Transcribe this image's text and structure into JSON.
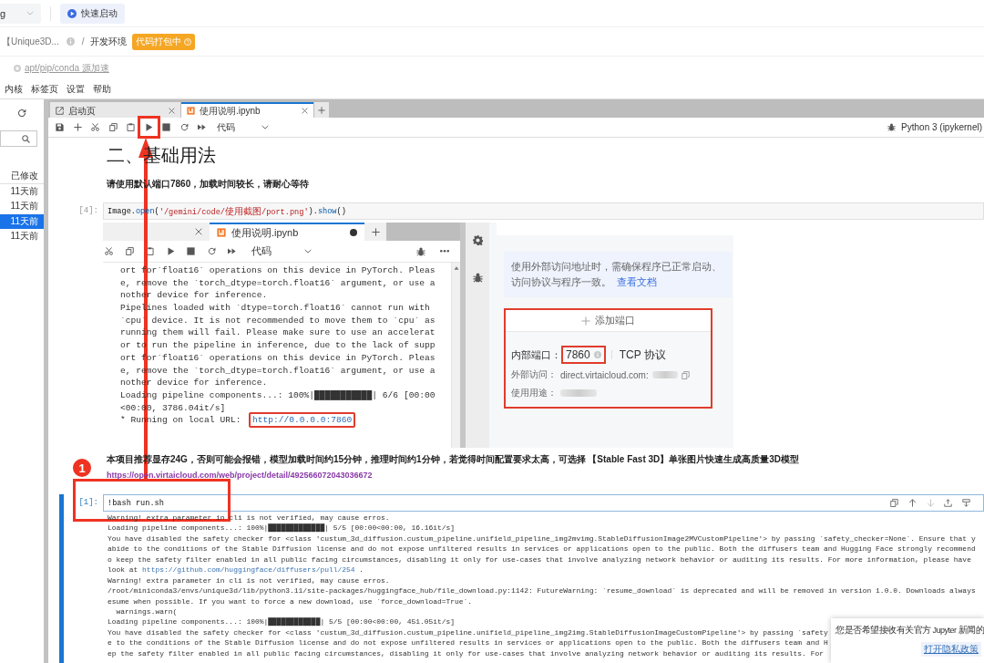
{
  "top_bar": {
    "dropdown": {
      "value": "g"
    },
    "quick_start": "快速启动"
  },
  "breadcrumb": {
    "project": "【Unique3D...",
    "separator": "/",
    "page": "开发环境",
    "badge": "代码打包中"
  },
  "mirror_link": "apt/pip/conda 源加速",
  "menu": [
    {
      "label": "内核"
    },
    {
      "label": "标签页"
    },
    {
      "label": "设置"
    },
    {
      "label": "帮助"
    }
  ],
  "file_browser": {
    "column": "已修改",
    "rows": [
      {
        "modified": "11天前",
        "selected": false
      },
      {
        "modified": "11天前",
        "selected": false
      },
      {
        "modified": "11天前",
        "selected": true
      },
      {
        "modified": "11天前",
        "selected": false
      }
    ]
  },
  "tabs": [
    {
      "label": "启动页",
      "kind": "launcher",
      "selected": false
    },
    {
      "label": "使用说明.ipynb",
      "kind": "notebook",
      "selected": true
    }
  ],
  "toolbar": {
    "buttons": [
      {
        "kind": "save",
        "highlighted": false
      },
      {
        "kind": "insert",
        "highlighted": false
      },
      {
        "kind": "cut",
        "highlighted": false
      },
      {
        "kind": "copy",
        "highlighted": false
      },
      {
        "kind": "paste",
        "highlighted": false
      },
      {
        "kind": "run",
        "highlighted": true
      },
      {
        "kind": "stop",
        "highlighted": false
      },
      {
        "kind": "restart",
        "highlighted": false
      },
      {
        "kind": "run_all",
        "highlighted": false
      }
    ],
    "cell_type": "代码",
    "kernel": "Python 3 (ipykernel)"
  },
  "cells": [
    {
      "kind": "heading",
      "text": "二、基础用法"
    },
    {
      "kind": "markdown",
      "paragraphs": [
        {
          "kind": "bold",
          "text": "请使用默认端口7860，加载时间较长，请耐心等待"
        }
      ]
    },
    {
      "kind": "code",
      "prompt": "[4]:",
      "active": false,
      "code": [
        {
          "kind": "plain",
          "text": "Image."
        },
        {
          "kind": "property",
          "text": "open"
        },
        {
          "kind": "plain",
          "text": "("
        },
        {
          "kind": "string",
          "text": "'/gemini/code/使用截图/port.png'"
        },
        {
          "kind": "plain",
          "text": ")."
        },
        {
          "kind": "property",
          "text": "show"
        },
        {
          "kind": "plain",
          "text": "()"
        }
      ],
      "output": {
        "kind": "screenshot",
        "notebook": {
          "tab": "使用说明.ipynb",
          "unsaved": true,
          "cell_type": "代码",
          "lines": [
            "ort for`float16` operations on this device in PyTorch. Pleas",
            "e, remove the `torch_dtype=torch.float16` argument, or use a",
            "nother device for inference.",
            "Pipelines loaded with `dtype=torch.float16` cannot run with",
            "`cpu` device. It is not recommended to move them to `cpu` as",
            "running them will fail. Please make sure to use an accelerat",
            "or to run the pipeline in inference, due to the lack of supp",
            "ort for`float16` operations on this device in PyTorch. Pleas",
            "e, remove the `torch_dtype=torch.float16` argument, or use a",
            "nother device for inference.",
            "Loading pipeline components...: 100%|███████████| 6/6 [00:00",
            "<00:00, 3786.04it/s]"
          ],
          "url_prefix": "* Running on local URL:  ",
          "url": "http://0.0.0.0:7860",
          "url_highlighted": true
        },
        "port_panel": {
          "notice": "使用外部访问地址时，需确保程序已正常启动、访问协议与程序一致。",
          "notice_link": "查看文档",
          "add_port": "添加端口",
          "highlighted": true,
          "internal_label": "内部端口：",
          "internal_port": "7860",
          "port_highlighted": true,
          "protocol": "TCP 协议",
          "external_label": "外部访问：",
          "external_host": "direct.virtaicloud.com:",
          "usage_label": "使用用途："
        }
      }
    },
    {
      "kind": "markdown",
      "paragraphs": [
        {
          "kind": "bold",
          "text": "本项目推荐显存24G，否则可能会报错，模型加载时间约15分钟，推理时间约1分钟，若觉得时间配置要求太高，可选择 【Stable Fast 3D】单张图片快速生成高质量3D模型"
        },
        {
          "kind": "link",
          "text": "https://open.virtaicloud.com/web/project/detail/492566072043036672"
        }
      ]
    },
    {
      "kind": "code",
      "prompt": "[1]:",
      "active": true,
      "code": [
        {
          "kind": "plain",
          "text": "!bash run.sh"
        }
      ],
      "cell_toolbar": [
        {
          "kind": "duplicate",
          "disabled": false
        },
        {
          "kind": "move_up",
          "disabled": false
        },
        {
          "kind": "move_down",
          "disabled": true
        },
        {
          "kind": "insert_above",
          "disabled": false
        },
        {
          "kind": "insert_below",
          "disabled": false
        }
      ],
      "annotation": {
        "badge": "1",
        "highlighted": true,
        "arrow": true
      },
      "output": {
        "kind": "stream",
        "lines": [
          {
            "text": "Warning! extra parameter in cli is not verified, may cause erros."
          },
          {
            "text": "Loading pipeline components...: 100%|█████████████| 5/5 [00:00<00:00, 16.16it/s]"
          },
          {
            "text": "You have disabled the safety checker for <class 'custum_3d_diffusion.custum_pipeline.unifield_pipeline_img2mvimg.StableDiffusionImage2MVCustomPipeline'> by passing `safety_checker=None`. Ensure that y"
          },
          {
            "text": "abide to the conditions of the Stable Diffusion license and do not expose unfiltered results in services or applications open to the public. Both the diffusers team and Hugging Face strongly recommend"
          },
          {
            "text": "o keep the safety filter enabled in all public facing circumstances, disabling it only for use-cases that involve analyzing network behavior or auditing its results. For more information, please have"
          },
          {
            "text": "look at ",
            "link": "https://github.com/huggingface/diffusers/pull/254",
            "tail": " ."
          },
          {
            "text": "Warning! extra parameter in cli is not verified, may cause erros."
          },
          {
            "text": "/root/miniconda3/envs/unique3d/lib/python3.11/site-packages/huggingface_hub/file_download.py:1142: FutureWarning: `resume_download` is deprecated and will be removed in version 1.0.0. Downloads always"
          },
          {
            "text": "esume when possible. If you want to force a new download, use `force_download=True`."
          },
          {
            "text": "  warnings.warn("
          },
          {
            "text": "Loading pipeline components...: 100%|████████████| 5/5 [00:00<00:00, 451.05it/s]"
          },
          {
            "text": "You have disabled the safety checker for <class 'custum_3d_diffusion.custum_pipeline.unifield_pipeline_img2img.StableDiffusionImageCustomPipeline'> by passing `safety"
          },
          {
            "text": "e to the conditions of the Stable Diffusion license and do not expose unfiltered results in services or applications open to the public. Both the diffusers team and H"
          },
          {
            "text": "ep the safety filter enabled in all public facing circumstances, disabling it only for use-cases that involve analyzing network behavior or auditing its results. For"
          }
        ]
      }
    }
  ],
  "notification": {
    "message": "您是否希望接收有关官方 Jupyter 新闻的",
    "link": "打开隐私政策"
  }
}
